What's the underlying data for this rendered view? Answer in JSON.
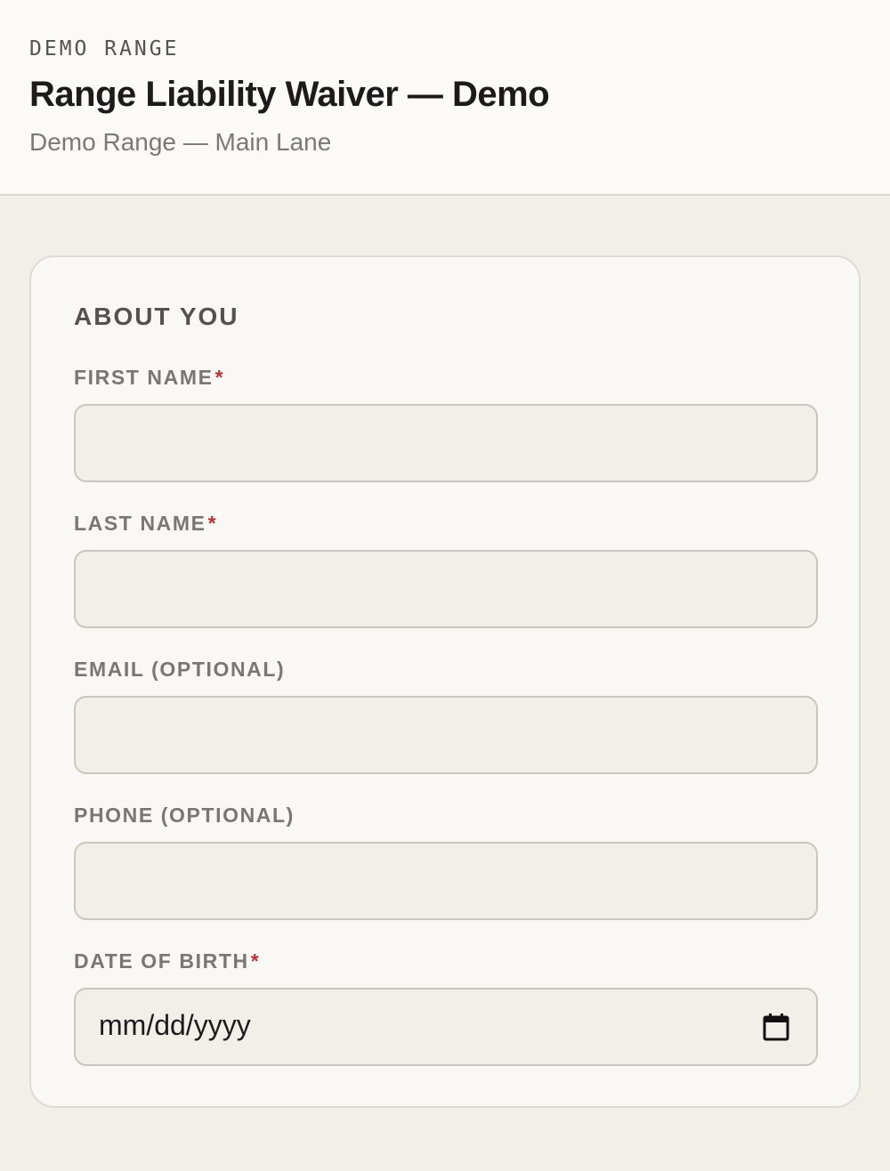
{
  "header": {
    "eyebrow": "DEMO RANGE",
    "title": "Range Liability Waiver — Demo",
    "subtitle": "Demo Range — Main Lane"
  },
  "form": {
    "section_title": "ABOUT YOU",
    "required_marker": "*",
    "fields": [
      {
        "label": "FIRST NAME",
        "required": true,
        "value": ""
      },
      {
        "label": "LAST NAME",
        "required": true,
        "value": ""
      },
      {
        "label": "EMAIL (OPTIONAL)",
        "required": false,
        "value": ""
      },
      {
        "label": "PHONE (OPTIONAL)",
        "required": false,
        "value": ""
      },
      {
        "label": "DATE OF BIRTH",
        "required": true,
        "placeholder": "mm/dd/yyyy",
        "icon": "calendar-icon"
      }
    ]
  },
  "colors": {
    "page_background": "#f2eee8",
    "header_background": "#fbfaf8",
    "card_background": "#f9f8f5",
    "required_marker": "#b3343a"
  }
}
